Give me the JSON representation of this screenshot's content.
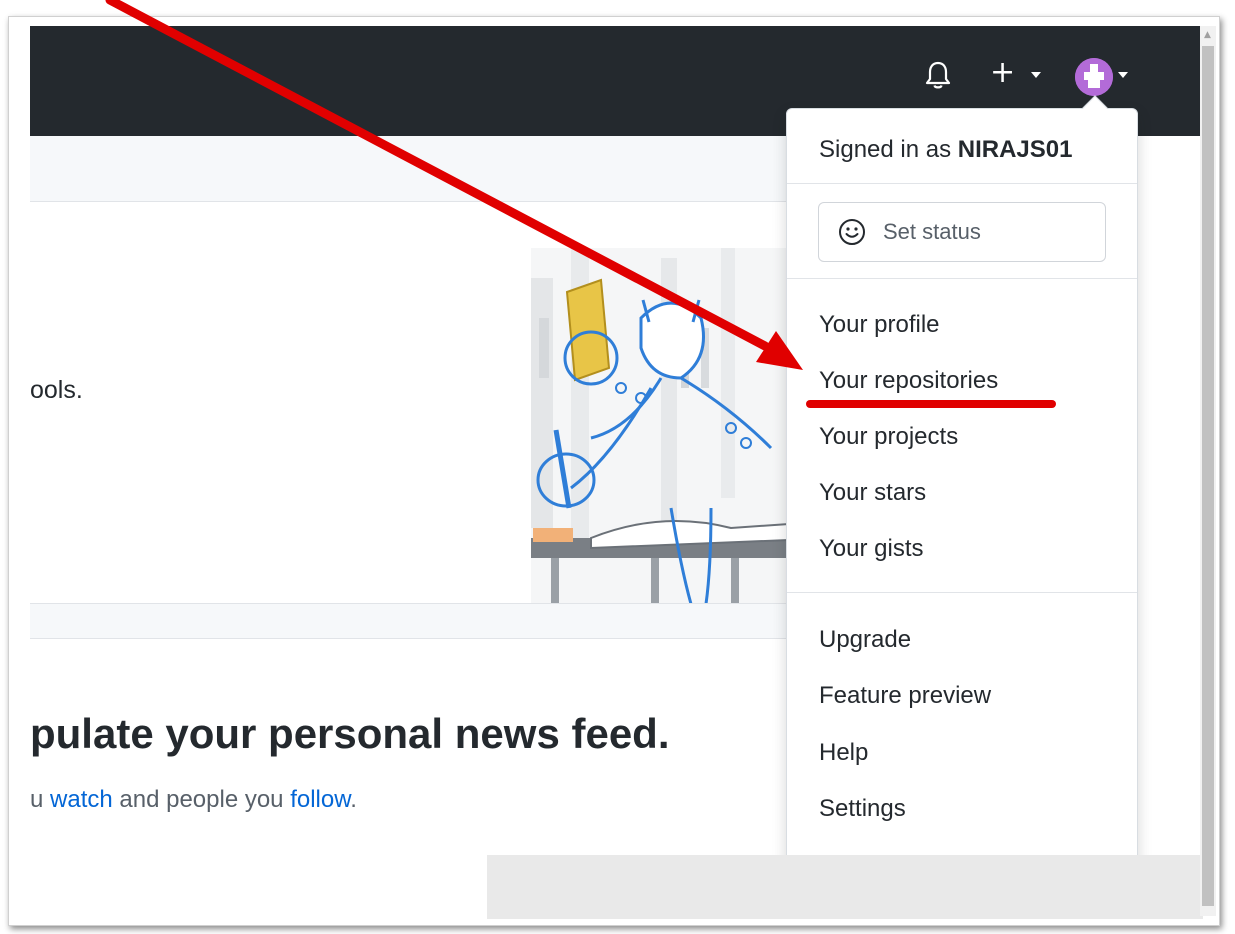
{
  "header": {
    "icons": [
      "bell-icon",
      "plus-icon",
      "caret-down-icon",
      "avatar",
      "caret-down-icon"
    ],
    "plus_symbol": "+"
  },
  "hero": {
    "partial_text": "ools."
  },
  "feed": {
    "heading": "pulate your personal news feed.",
    "sub_prefix": "u ",
    "watch_link": "watch",
    "sub_middle": " and people you ",
    "follow_link": "follow",
    "sub_suffix": "."
  },
  "dropdown": {
    "signed_in_prefix": "Signed in as ",
    "username": "NIRAJS01",
    "set_status": "Set status",
    "items_group1": [
      "Your profile",
      "Your repositories",
      "Your projects",
      "Your stars",
      "Your gists"
    ],
    "items_group2": [
      "Upgrade",
      "Feature preview",
      "Help",
      "Settings"
    ]
  },
  "annotation": {
    "color": "#e00000",
    "highlighted_item": "Your repositories"
  },
  "colors": {
    "header_bg": "#24292e",
    "link": "#0366d6",
    "avatar": "#b36bd8"
  }
}
